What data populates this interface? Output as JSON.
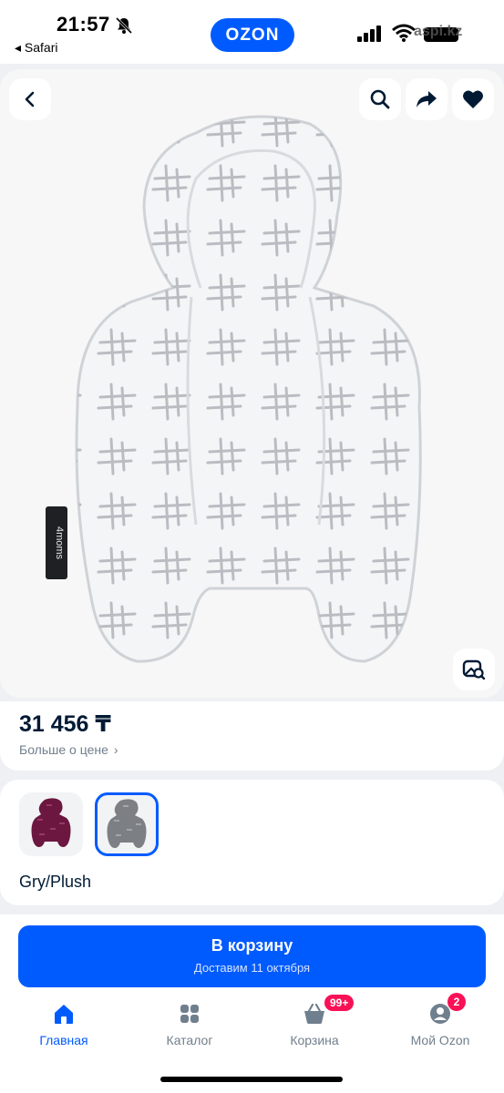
{
  "status_bar": {
    "time": "21:57",
    "back_app": "◂ Safari",
    "brand": "OZON",
    "watermark": "aspi.kz"
  },
  "product": {
    "price": "31 456 ₸",
    "price_more": "Больше о цене",
    "selected_variant": "Gry/Plush",
    "variants": [
      "Purple",
      "Gry/Plush"
    ],
    "label_text": "4moms"
  },
  "cart_button": {
    "label": "В корзину",
    "delivery": "Доставим 11 октября"
  },
  "tabbar": {
    "items": [
      {
        "label": "Главная",
        "icon": "home-icon"
      },
      {
        "label": "Каталог",
        "icon": "catalog-icon"
      },
      {
        "label": "Корзина",
        "icon": "cart-icon",
        "badge": "99+"
      },
      {
        "label": "Мой Ozon",
        "icon": "profile-icon",
        "badge": "2"
      }
    ]
  },
  "colors": {
    "accent": "#005bff",
    "badge": "#f91155"
  }
}
